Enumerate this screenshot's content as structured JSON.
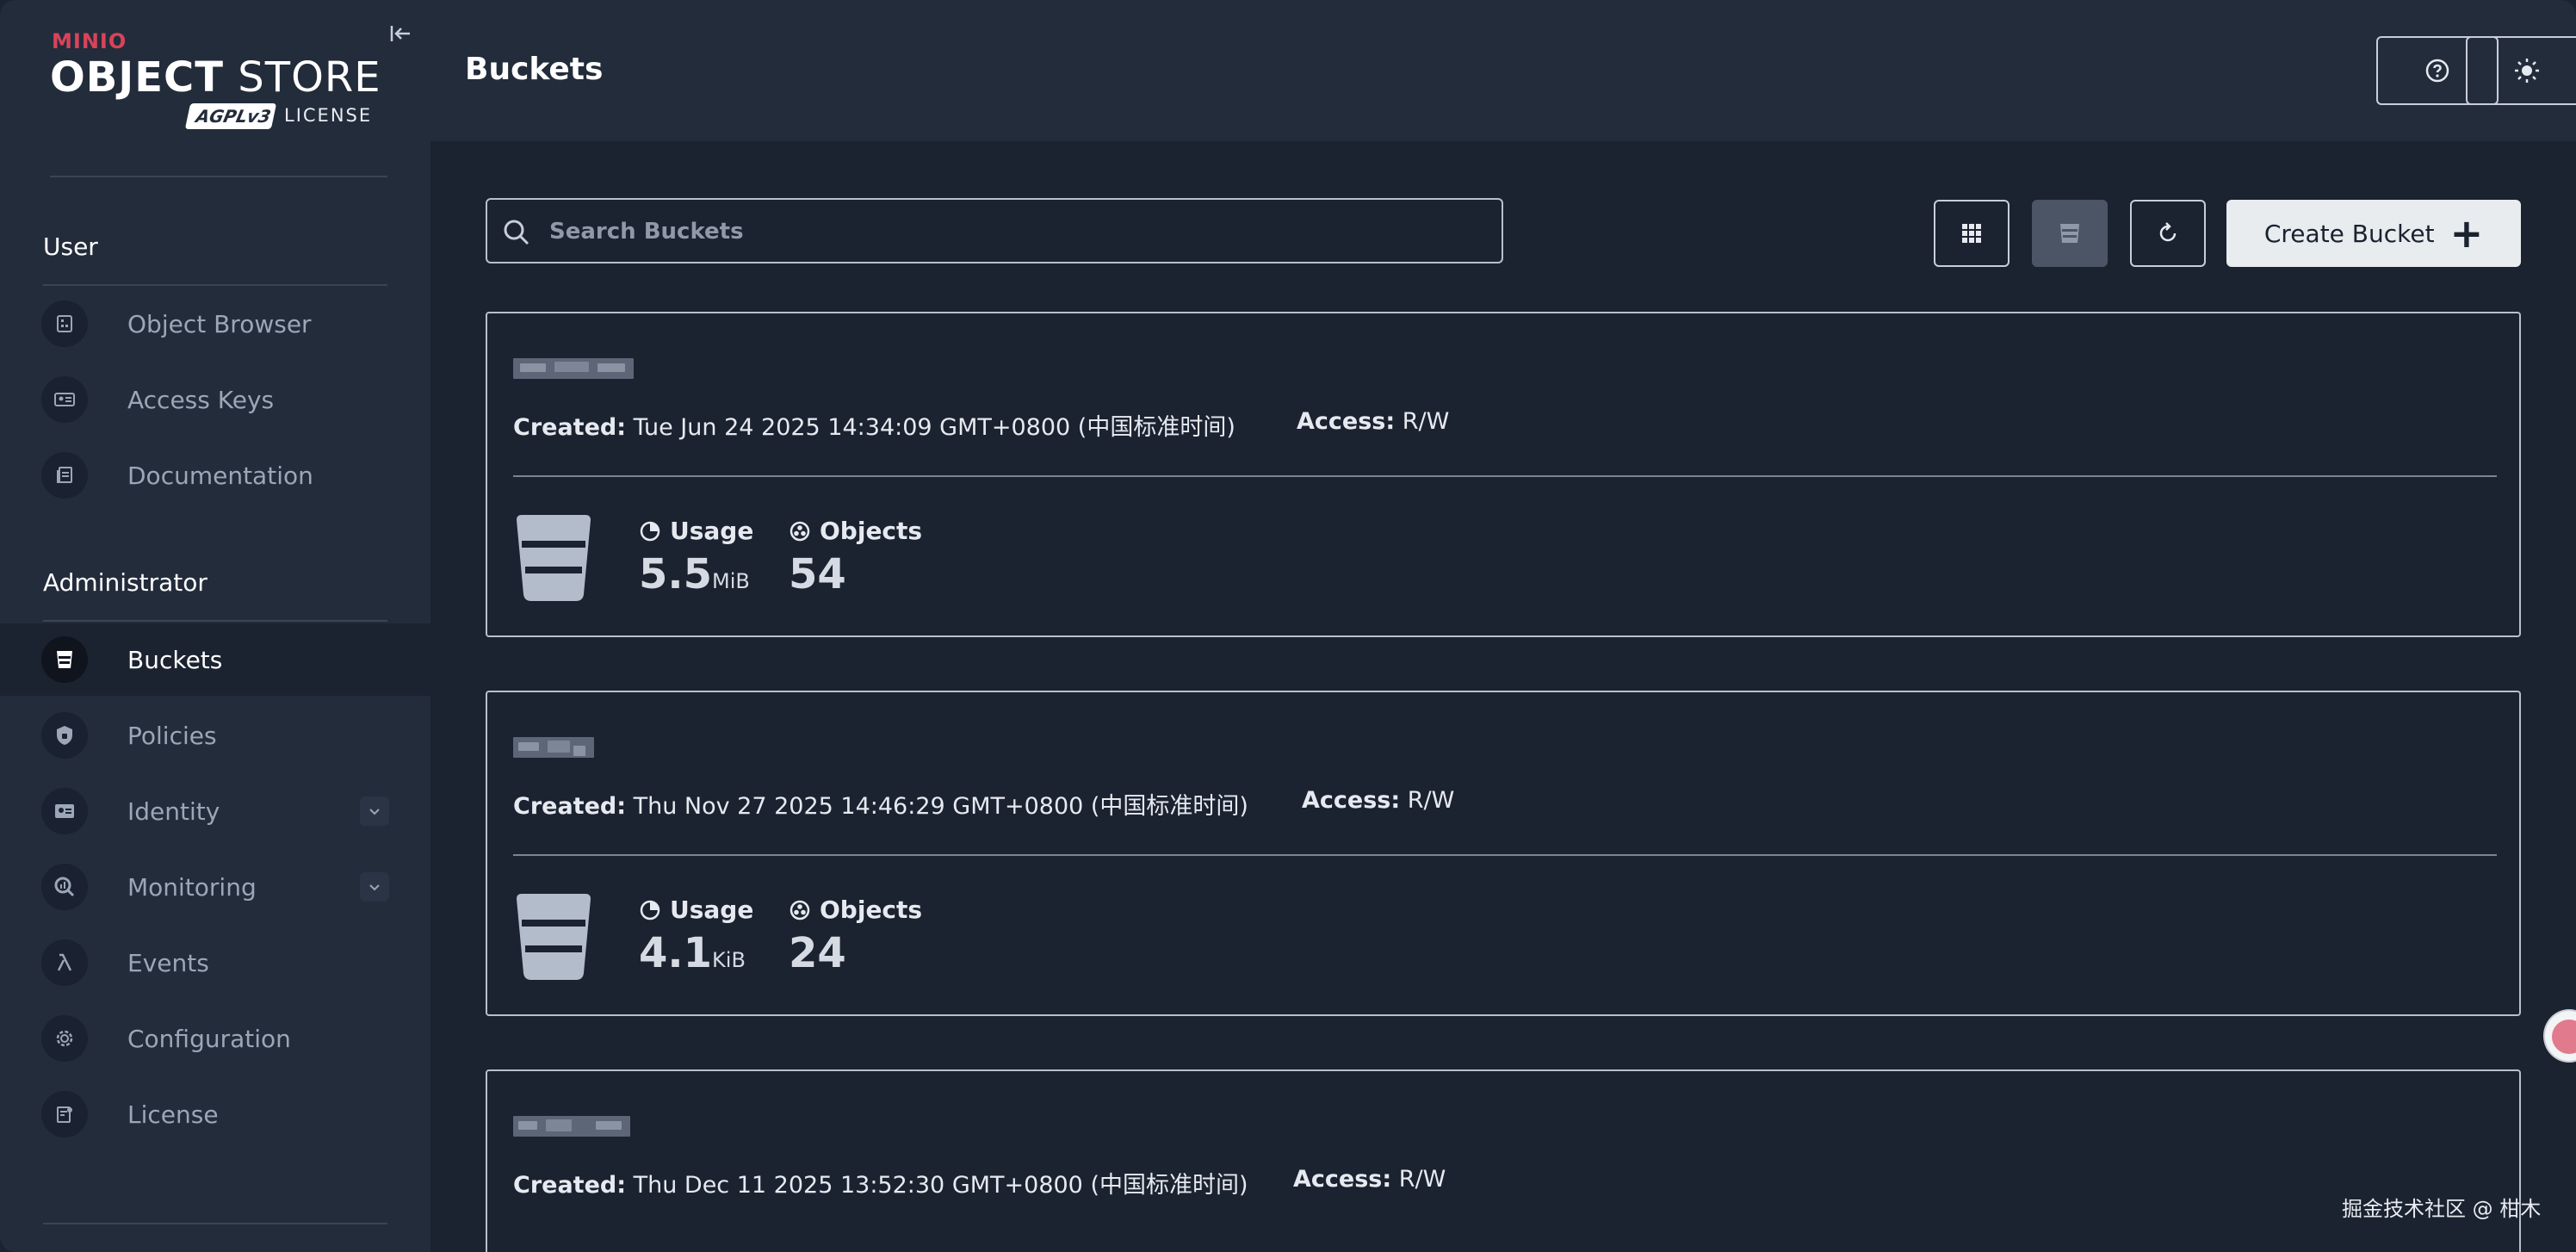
{
  "brand": {
    "minio": "MINIO",
    "product_bold": "OBJECT",
    "product_thin": "STORE",
    "agpl": "AGPLv3",
    "license": "LICENSE"
  },
  "sidebar": {
    "user_section": "User",
    "user_items": [
      {
        "label": "Object Browser",
        "icon": "object-browser-icon"
      },
      {
        "label": "Access Keys",
        "icon": "access-keys-icon"
      },
      {
        "label": "Documentation",
        "icon": "documentation-icon"
      }
    ],
    "admin_section": "Administrator",
    "admin_items": [
      {
        "label": "Buckets",
        "icon": "bucket-icon",
        "active": true
      },
      {
        "label": "Policies",
        "icon": "policies-icon"
      },
      {
        "label": "Identity",
        "icon": "identity-icon",
        "expandable": true
      },
      {
        "label": "Monitoring",
        "icon": "monitoring-icon",
        "expandable": true
      },
      {
        "label": "Events",
        "icon": "lambda-icon"
      },
      {
        "label": "Configuration",
        "icon": "gear-icon"
      },
      {
        "label": "License",
        "icon": "license-icon"
      }
    ]
  },
  "header": {
    "title": "Buckets",
    "help_icon": "help-icon",
    "theme_icon": "sun-icon"
  },
  "toolbar": {
    "search_placeholder": "Search Buckets",
    "grid_view_icon": "grid-view-icon",
    "list_view_icon": "list-view-icon",
    "refresh_icon": "refresh-icon",
    "create_label": "Create Bucket",
    "create_icon": "plus-icon"
  },
  "buckets": [
    {
      "created_label": "Created:",
      "created": "Tue Jun 24 2025 14:34:09 GMT+0800 (中国标准时间)",
      "access_label": "Access:",
      "access": "R/W",
      "usage_label": "Usage",
      "usage_value": "5.5",
      "usage_unit": "MiB",
      "objects_label": "Objects",
      "objects_value": "54"
    },
    {
      "created_label": "Created:",
      "created": "Thu Nov 27 2025 14:46:29 GMT+0800 (中国标准时间)",
      "access_label": "Access:",
      "access": "R/W",
      "usage_label": "Usage",
      "usage_value": "4.1",
      "usage_unit": "KiB",
      "objects_label": "Objects",
      "objects_value": "24"
    },
    {
      "created_label": "Created:",
      "created": "Thu Dec 11 2025 13:52:30 GMT+0800 (中国标准时间)",
      "access_label": "Access:",
      "access": "R/W"
    }
  ],
  "watermark": "掘金技术社区 @ 柑木",
  "colors": {
    "sidebar_bg": "#232c3b",
    "main_bg": "#1b2230",
    "minio_red": "#d9435a",
    "create_button_bg": "#e8ecef"
  }
}
